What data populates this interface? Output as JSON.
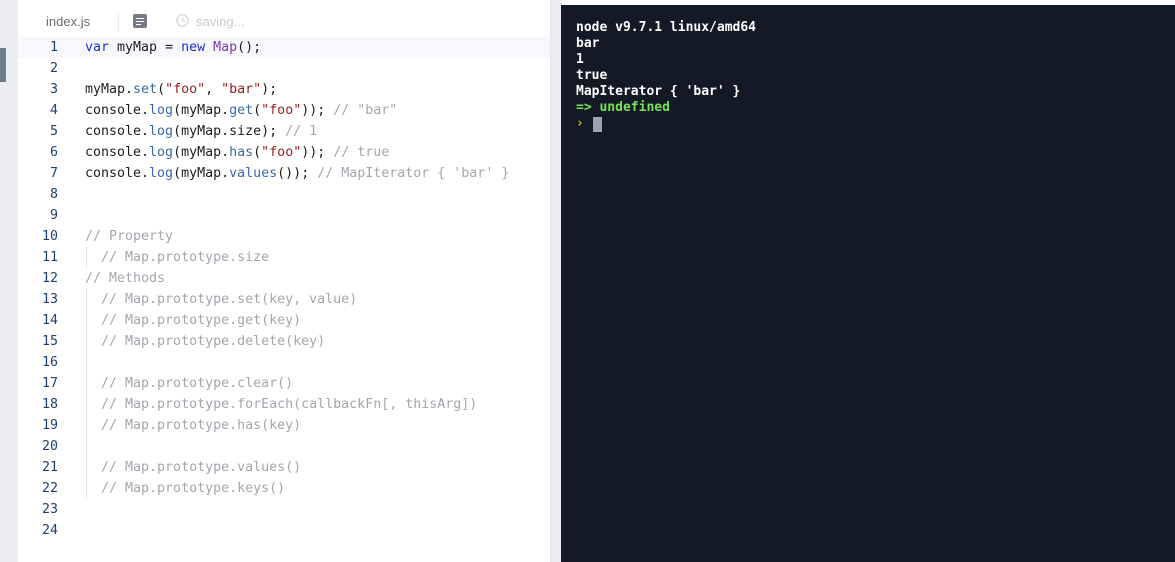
{
  "editor": {
    "tab": {
      "filename": "index.js",
      "status": "saving..."
    },
    "icons": {
      "doc": "document-icon",
      "saving": "history-icon"
    },
    "active_line": 1,
    "lines": [
      {
        "number": "1",
        "tokens": [
          {
            "text": "var",
            "type": "keyword"
          },
          {
            "text": " myMap = ",
            "type": "punct"
          },
          {
            "text": "new",
            "type": "keyword"
          },
          {
            "text": " ",
            "type": "punct"
          },
          {
            "text": "Map",
            "type": "class"
          },
          {
            "text": "();",
            "type": "punct"
          }
        ]
      },
      {
        "number": "2",
        "tokens": []
      },
      {
        "number": "3",
        "tokens": [
          {
            "text": "myMap.",
            "type": "punct"
          },
          {
            "text": "set",
            "type": "prop"
          },
          {
            "text": "(",
            "type": "punct"
          },
          {
            "text": "\"foo\"",
            "type": "string"
          },
          {
            "text": ", ",
            "type": "punct"
          },
          {
            "text": "\"bar\"",
            "type": "string"
          },
          {
            "text": ");",
            "type": "punct"
          }
        ]
      },
      {
        "number": "4",
        "tokens": [
          {
            "text": "console.",
            "type": "punct"
          },
          {
            "text": "log",
            "type": "prop"
          },
          {
            "text": "(myMap.",
            "type": "punct"
          },
          {
            "text": "get",
            "type": "prop"
          },
          {
            "text": "(",
            "type": "punct"
          },
          {
            "text": "\"foo\"",
            "type": "string"
          },
          {
            "text": ")); ",
            "type": "punct"
          },
          {
            "text": "// \"bar\"",
            "type": "comment"
          }
        ]
      },
      {
        "number": "5",
        "tokens": [
          {
            "text": "console.",
            "type": "punct"
          },
          {
            "text": "log",
            "type": "prop"
          },
          {
            "text": "(myMap.size); ",
            "type": "punct"
          },
          {
            "text": "// 1",
            "type": "comment"
          }
        ]
      },
      {
        "number": "6",
        "tokens": [
          {
            "text": "console.",
            "type": "punct"
          },
          {
            "text": "log",
            "type": "prop"
          },
          {
            "text": "(myMap.",
            "type": "punct"
          },
          {
            "text": "has",
            "type": "prop"
          },
          {
            "text": "(",
            "type": "punct"
          },
          {
            "text": "\"foo\"",
            "type": "string"
          },
          {
            "text": ")); ",
            "type": "punct"
          },
          {
            "text": "// true",
            "type": "comment"
          }
        ]
      },
      {
        "number": "7",
        "tokens": [
          {
            "text": "console.",
            "type": "punct"
          },
          {
            "text": "log",
            "type": "prop"
          },
          {
            "text": "(myMap.",
            "type": "punct"
          },
          {
            "text": "values",
            "type": "prop"
          },
          {
            "text": "()); ",
            "type": "punct"
          },
          {
            "text": "// MapIterator { 'bar' }",
            "type": "comment"
          }
        ]
      },
      {
        "number": "8",
        "tokens": []
      },
      {
        "number": "9",
        "tokens": []
      },
      {
        "number": "10",
        "tokens": [
          {
            "text": "// Property",
            "type": "comment"
          }
        ]
      },
      {
        "number": "11",
        "indent": true,
        "tokens": [
          {
            "text": "  // Map.prototype.size",
            "type": "comment"
          }
        ]
      },
      {
        "number": "12",
        "tokens": [
          {
            "text": "// Methods",
            "type": "comment"
          }
        ]
      },
      {
        "number": "13",
        "indent": true,
        "tokens": [
          {
            "text": "  // Map.prototype.set(key, value)",
            "type": "comment"
          }
        ]
      },
      {
        "number": "14",
        "indent": true,
        "tokens": [
          {
            "text": "  // Map.prototype.get(key)",
            "type": "comment"
          }
        ]
      },
      {
        "number": "15",
        "indent": true,
        "tokens": [
          {
            "text": "  // Map.prototype.delete(key)",
            "type": "comment"
          }
        ]
      },
      {
        "number": "16",
        "indent": true,
        "tokens": []
      },
      {
        "number": "17",
        "indent": true,
        "tokens": [
          {
            "text": "  // Map.prototype.clear()",
            "type": "comment"
          }
        ]
      },
      {
        "number": "18",
        "indent": true,
        "tokens": [
          {
            "text": "  // Map.prototype.forEach(callbackFn[, thisArg])",
            "type": "comment"
          }
        ]
      },
      {
        "number": "19",
        "indent": true,
        "tokens": [
          {
            "text": "  // Map.prototype.has(key)",
            "type": "comment"
          }
        ]
      },
      {
        "number": "20",
        "indent": true,
        "tokens": []
      },
      {
        "number": "21",
        "indent": true,
        "tokens": [
          {
            "text": "  // Map.prototype.values()",
            "type": "comment"
          }
        ]
      },
      {
        "number": "22",
        "indent": true,
        "tokens": [
          {
            "text": "  // Map.prototype.keys()",
            "type": "comment"
          }
        ]
      },
      {
        "number": "23",
        "tokens": []
      },
      {
        "number": "24",
        "tokens": []
      }
    ]
  },
  "console": {
    "lines": [
      {
        "text": "node v9.7.1 linux/amd64",
        "kind": "output"
      },
      {
        "text": "bar",
        "kind": "output"
      },
      {
        "text": "1",
        "kind": "output"
      },
      {
        "text": "true",
        "kind": "output"
      },
      {
        "text": "MapIterator { 'bar' }",
        "kind": "output"
      },
      {
        "text": "=> undefined",
        "kind": "result"
      }
    ],
    "prompt_symbol": "›",
    "prompt_icon": "prompt-chevron-icon"
  },
  "colors": {
    "console_bg": "#141a25",
    "result_green": "#7be05a",
    "prompt_yellow": "#e8b321",
    "keyword_blue": "#1a2ed7",
    "string_red": "#9a1d1d",
    "comment_gray": "#a2a7ad",
    "line_number_navy": "#1d4070"
  }
}
